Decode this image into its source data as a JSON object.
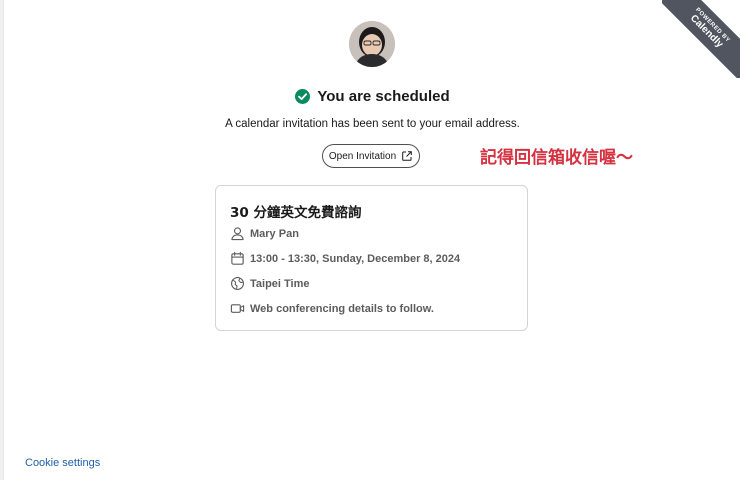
{
  "ribbon": {
    "powered_by": "POWERED BY",
    "brand": "Calendly"
  },
  "header": {
    "title": "You are scheduled",
    "subtitle": "A calendar invitation has been sent to your email address."
  },
  "actions": {
    "open_invitation_label": "Open Invitation"
  },
  "annotation": {
    "text": "記得回信箱收信喔～"
  },
  "event": {
    "title": "30 分鐘英文免費諮詢",
    "host": "Mary Pan",
    "datetime": "13:00 - 13:30, Sunday, December 8, 2024",
    "timezone": "Taipei Time",
    "location": "Web conferencing details to follow."
  },
  "footer": {
    "cookie_settings": "Cookie settings"
  },
  "colors": {
    "success": "#0a8a5f",
    "annotation": "#d43240",
    "link": "#1f5fa8",
    "ribbon": "#505560"
  }
}
